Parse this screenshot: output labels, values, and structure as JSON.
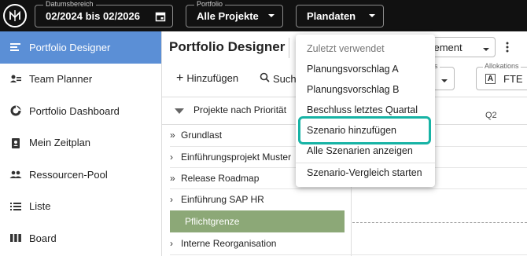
{
  "topbar": {
    "date_range": {
      "label": "Datumsbereich",
      "value": "02/2024 bis 02/2026",
      "icon": "calendar-icon"
    },
    "portfolio": {
      "label": "Portfolio",
      "value": "Alle Projekte",
      "icon": "chevron-down-icon"
    },
    "data_source": {
      "value": "Plandaten",
      "icon": "chevron-down-icon"
    }
  },
  "sidebar": {
    "items": [
      {
        "label": "Portfolio Designer",
        "icon": "portfolio-designer-icon",
        "active": true
      },
      {
        "label": "Team Planner",
        "icon": "team-planner-icon"
      },
      {
        "label": "Portfolio Dashboard",
        "icon": "dashboard-icon"
      },
      {
        "label": "Mein Zeitplan",
        "icon": "schedule-icon"
      },
      {
        "label": "Ressourcen-Pool",
        "icon": "resource-pool-icon"
      },
      {
        "label": "Liste",
        "icon": "list-icon"
      },
      {
        "label": "Board",
        "icon": "board-icon"
      }
    ]
  },
  "main": {
    "title": "Portfolio Designer",
    "view_select": "agement",
    "add_label": "Hinzufügen",
    "search_label": "Such",
    "filter_status_label": "us",
    "allocation": {
      "label": "Allokations",
      "value": "FTE"
    },
    "group_header": "Projekte nach Priorität",
    "timeline_label": "Q2",
    "rows": [
      {
        "label": "Grundlast",
        "chevron": "»"
      },
      {
        "label": "Einführungsprojekt Muster",
        "chevron": "›"
      },
      {
        "label": "Release Roadmap",
        "chevron": "»"
      },
      {
        "label": "Einführung SAP HR",
        "chevron": "›"
      },
      {
        "label": "Pflichtgrenze",
        "chevron": ""
      },
      {
        "label": "Interne Reorganisation",
        "chevron": "›"
      }
    ]
  },
  "menu": {
    "items": [
      {
        "label": "Zuletzt verwendet",
        "muted": true
      },
      {
        "label": "Planungsvorschlag A"
      },
      {
        "label": "Planungsvorschlag B"
      },
      {
        "label": "Beschluss letztes Quartal"
      },
      {
        "label": "Szenario hinzufügen",
        "highlighted": true
      },
      {
        "label": "Alle Szenarien anzeigen"
      },
      {
        "label": "Szenario-Vergleich starten"
      }
    ]
  },
  "colors": {
    "topbar": "#111111",
    "active_nav": "#5b8fd6",
    "pflicht": "#8ca877",
    "highlight": "#17b3a5"
  }
}
